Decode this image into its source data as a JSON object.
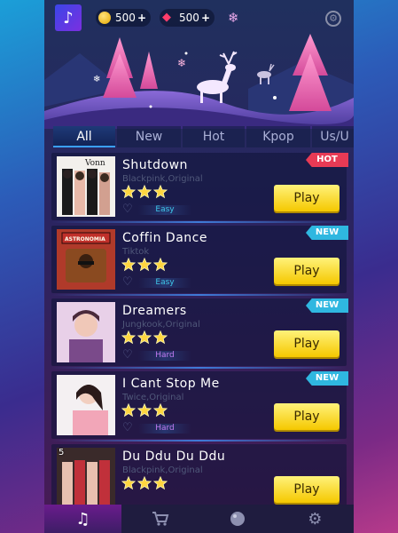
{
  "header": {
    "avatar_icon": "music-note-icon",
    "coins": "500",
    "gems": "500",
    "plus": "+"
  },
  "tabs": [
    {
      "label": "All",
      "active": true
    },
    {
      "label": "New",
      "active": false
    },
    {
      "label": "Hot",
      "active": false
    },
    {
      "label": "Kpop",
      "active": false
    },
    {
      "label": "Us/U",
      "active": false
    }
  ],
  "songs": [
    {
      "rank": "",
      "title": "Shutdown",
      "artist": "Blackpink,Original",
      "stars": 3,
      "difficulty": "Easy",
      "badge": "HOT",
      "play": "Play"
    },
    {
      "rank": "",
      "title": "Coffin Dance",
      "artist": "Tiktok",
      "stars": 3,
      "difficulty": "Easy",
      "badge": "NEW",
      "play": "Play"
    },
    {
      "rank": "",
      "title": "Dreamers",
      "artist": "Jungkook,Original",
      "stars": 3,
      "difficulty": "Hard",
      "badge": "NEW",
      "play": "Play"
    },
    {
      "rank": "",
      "title": "I Cant Stop Me",
      "artist": "Twice,Original",
      "stars": 3,
      "difficulty": "Hard",
      "badge": "NEW",
      "play": "Play"
    },
    {
      "rank": "5",
      "title": "Du Ddu Du Ddu",
      "artist": "Blackpink,Original",
      "stars": 3,
      "difficulty": "",
      "badge": "",
      "play": "Play"
    }
  ],
  "nav": [
    {
      "icon": "music-note-icon",
      "active": true
    },
    {
      "icon": "cart-icon",
      "active": false
    },
    {
      "icon": "disc-icon",
      "active": false
    },
    {
      "icon": "gear-icon",
      "active": false
    }
  ],
  "colors": {
    "accent_play": "#f5c800",
    "hot": "#e83a55",
    "new": "#2fb7e0",
    "easy": "#3fc6e8",
    "hard": "#c07af0"
  }
}
